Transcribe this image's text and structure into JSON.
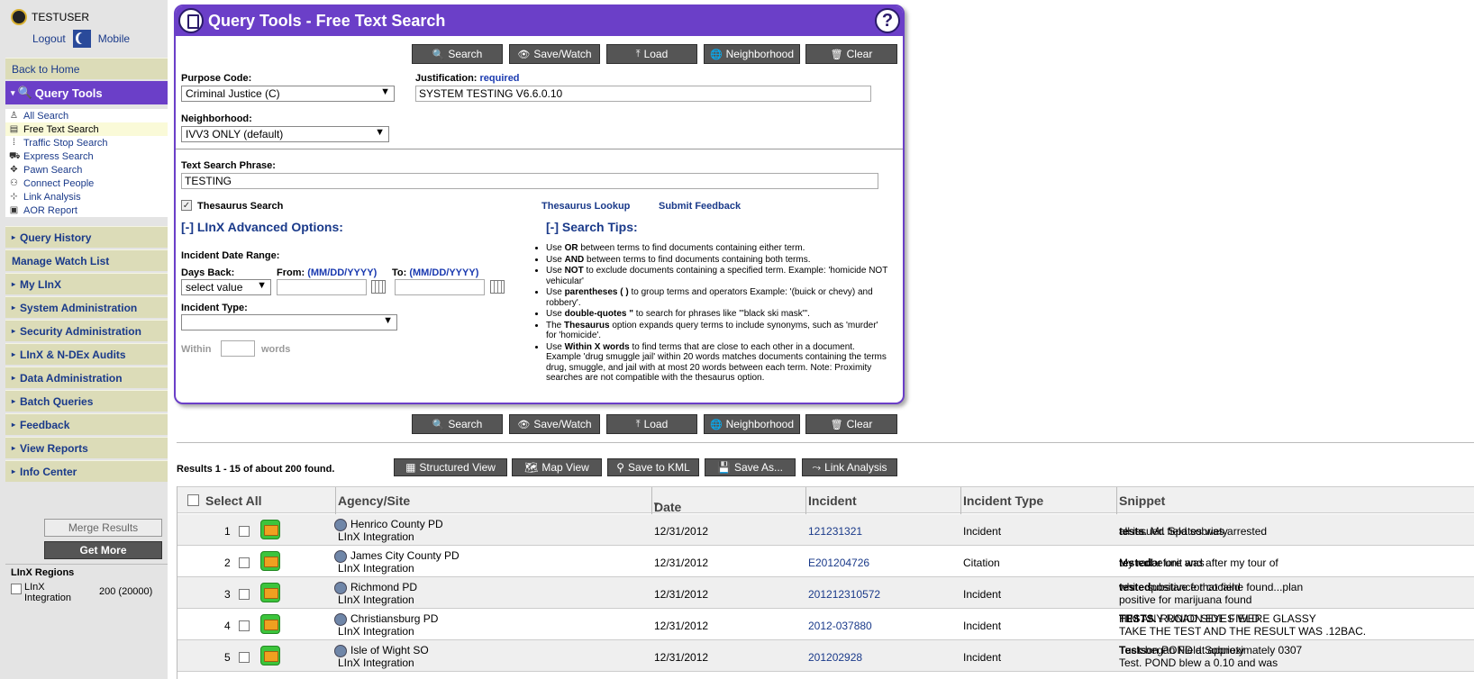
{
  "user": {
    "name": "TESTUSER",
    "logout": "Logout",
    "mobile": "Mobile"
  },
  "sidebar": {
    "back_home": "Back to Home",
    "active": "Query Tools",
    "sub": [
      {
        "label": "All Search",
        "icon": "person-icon"
      },
      {
        "label": "Free Text Search",
        "icon": "document-icon"
      },
      {
        "label": "Traffic Stop Search",
        "icon": "traffic-light-icon"
      },
      {
        "label": "Express Search",
        "icon": "car-icon"
      },
      {
        "label": "Pawn Search",
        "icon": "pawn-icon"
      },
      {
        "label": "Connect People",
        "icon": "people-icon"
      },
      {
        "label": "Link Analysis",
        "icon": "network-icon"
      },
      {
        "label": "AOR Report",
        "icon": "report-icon"
      }
    ],
    "items": [
      "Query History",
      "Manage Watch List",
      "My LInX",
      "System Administration",
      "Security Administration",
      "LInX & N-DEx Audits",
      "Data Administration",
      "Batch Queries",
      "Feedback",
      "View Reports",
      "Info Center"
    ],
    "merge": "Merge Results",
    "get_more": "Get More",
    "regions_title": "LInX Regions",
    "region_label": "LInX Integration",
    "region_count": "200 (20000)"
  },
  "panel": {
    "title": "Query Tools - Free Text Search",
    "buttons": {
      "search": "Search",
      "save": "Save/Watch",
      "load": "Load",
      "neighborhood": "Neighborhood",
      "clear": "Clear"
    },
    "purpose_label": "Purpose Code:",
    "purpose_value": "Criminal Justice (C)",
    "justification_label": "Justification:",
    "justification_req": "required",
    "justification_value": "SYSTEM TESTING V6.6.0.10",
    "neighborhood_label": "Neighborhood:",
    "neighborhood_value": "IVV3 ONLY (default)",
    "phrase_label": "Text Search Phrase:",
    "phrase_value": "TESTING",
    "thesaurus": "Thesaurus Search",
    "thesaurus_lookup": "Thesaurus Lookup",
    "submit_feedback": "Submit Feedback",
    "adv_title": "[-] LInX Advanced Options:",
    "tips_title": "[-] Search Tips:",
    "date_range": "Incident Date Range:",
    "days_back": "Days Back:",
    "days_value": "select value",
    "from": "From:",
    "to": "To:",
    "date_fmt": "(MM/DD/YYYY)",
    "incident_type": "Incident Type:",
    "within": "Within",
    "words": "words",
    "tips": [
      [
        "Use ",
        "OR",
        " between terms to find documents containing either term."
      ],
      [
        "Use ",
        "AND",
        " between terms to find documents containing both terms."
      ],
      [
        "Use ",
        "NOT",
        " to exclude documents containing a specified term. Example: 'homicide NOT vehicular'"
      ],
      [
        "Use ",
        "parentheses ( )",
        " to group terms and operators Example: '(buick or chevy) and robbery'."
      ],
      [
        "Use ",
        "double-quotes \"",
        " to search for phrases like '\"black ski mask\"'."
      ],
      [
        "The ",
        "Thesaurus",
        " option expands query terms to include synonyms, such as 'murder' for 'homicide'."
      ],
      [
        "Use ",
        "Within X words",
        " to find terms that are close to each other in a document. Example 'drug smuggle jail' within 20 words matches documents containing the terms drug, smuggle, and jail with at most 20 words between each term. Note: Proximity searches are not compatible with the thesaurus option."
      ]
    ]
  },
  "results": {
    "summary": "Results 1 - 15 of about 200 found.",
    "toolbar": {
      "structured": "Structured View",
      "map": "Map View",
      "kml": "Save to KML",
      "saveas": "Save As...",
      "link": "Link Analysis"
    },
    "headers": {
      "select": "Select All",
      "agency": "Agency/Site",
      "date": "Date",
      "incident": "Incident",
      "type": "Incident Type",
      "snippet": "Snippet"
    },
    "rows": [
      {
        "n": "1",
        "agency": "Henrico County PD",
        "site": "LInX Integration",
        "date": "12/31/2012",
        "incident": "121231321",
        "type": "Incident",
        "snippet_a": "all issued field sobriety ",
        "snippet_b": "tests",
        "snippet_c": ". Mr. Spates was arrested",
        "snippet2": ""
      },
      {
        "n": "2",
        "agency": "James City County PD",
        "site": "LInX Integration",
        "date": "12/31/2012",
        "incident": "E201204726",
        "type": "Citation",
        "snippet_a": "My radar unit was ",
        "snippet_b": "tested",
        "snippet_c": " before and after my tour of",
        "snippet2": ""
      },
      {
        "n": "3",
        "agency": "Richmond PD",
        "site": "LInX Integration",
        "date": "12/31/2012",
        "incident": "201212310572",
        "type": "Incident",
        "snippet_a": "white substance that field ",
        "snippet_b": "tested",
        "snippet_c": " positive for cocaine found...plan",
        "snippet2": "positive for marijuana found"
      },
      {
        "n": "4",
        "agency": "Christiansburg PD",
        "site": "LInX Integration",
        "date": "12/31/2012",
        "incident": "2012-037880",
        "type": "Incident",
        "snippet_a": "HIM ANY ROAD SIDE FIELD ",
        "snippet_b": "TESTS",
        "snippet_c": ". RUNION EYES WERE GLASSY",
        "snippet2": "TAKE THE TEST AND THE RESULT WAS .12BAC."
      },
      {
        "n": "5",
        "agency": "Isle of Wight SO",
        "site": "LInX Integration",
        "date": "12/31/2012",
        "incident": "201202928",
        "type": "Incident",
        "snippet_a": "Tuck began Field Sobriety ",
        "snippet_b": "Tests",
        "snippet_c": " on POND at approximately 0307",
        "snippet2": "Test. POND blew a 0.10 and was"
      }
    ]
  }
}
